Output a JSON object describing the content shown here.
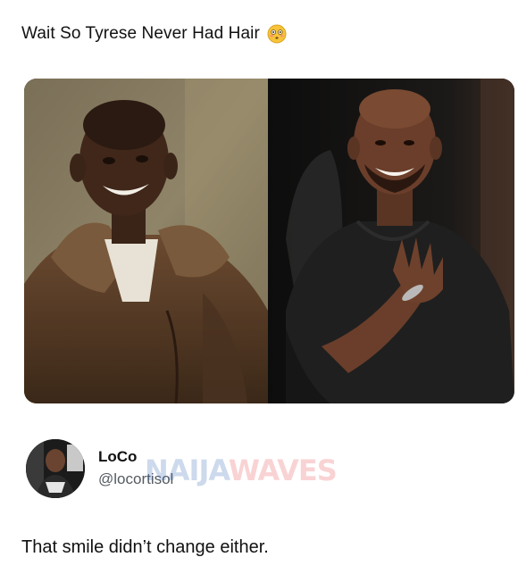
{
  "post": {
    "title": "Wait So Tyrese Never Had Hair",
    "title_emoji": "flushed-face-icon",
    "photo_left": "childhood-portrait-photo",
    "photo_right": "adult-portrait-photo"
  },
  "reply": {
    "display_name": "LoCo",
    "handle": "@locortisol",
    "text": "That smile didn’t change either.",
    "watermark_part1": "NAIJA",
    "watermark_part2": "WAVES"
  },
  "colors": {
    "text_primary": "#111111",
    "text_secondary": "#555b61",
    "watermark_blue": "#2c5fb0",
    "watermark_red": "#e7454a",
    "background": "#ffffff"
  }
}
